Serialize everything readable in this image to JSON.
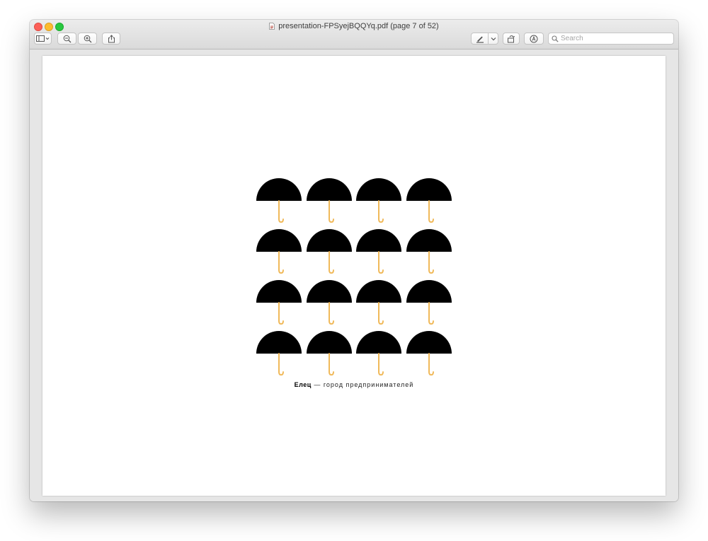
{
  "window": {
    "title": "presentation-FPSyejBQQYq.pdf (page 7 of 52)"
  },
  "toolbar": {
    "sidebar_icon": "sidebar-toggle-icon",
    "zoom_out_icon": "zoom-out-icon",
    "zoom_in_icon": "zoom-in-icon",
    "share_icon": "share-icon",
    "markup_icon": "pen-icon",
    "rotate_icon": "rotate-icon",
    "annotate_icon": "markup-circle-icon"
  },
  "search": {
    "placeholder": "Search"
  },
  "page": {
    "umbrella_count": 16,
    "umbrella_canopy_color": "#000000",
    "umbrella_handle_color": "#f0b95a",
    "caption_bold": "Елец",
    "caption_rest": " — город предпринимателей"
  }
}
